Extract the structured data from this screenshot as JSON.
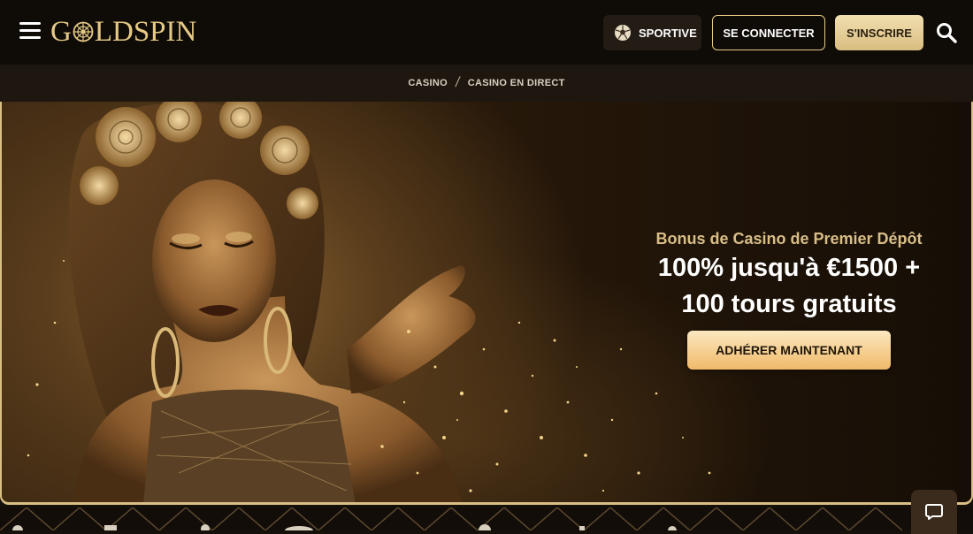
{
  "header": {
    "logo_text_1": "G",
    "logo_text_2": "LDSPIN",
    "sport_label": "SPORTIVE",
    "login_label": "SE CONNECTER",
    "register_label": "S'INSCRIRE"
  },
  "breadcrumb": {
    "items": [
      "CASINO",
      "CASINO EN DIRECT"
    ],
    "separator": "/"
  },
  "hero": {
    "subtitle": "Bonus de Casino de Premier Dépôt",
    "title_line1": "100% jusqu'à €1500 +",
    "title_line2": "100 tours gratuits",
    "cta_label": "ADHÉRER MAINTENANT"
  },
  "colors": {
    "gold": "#e5c985",
    "header_bg": "#0f0b07",
    "crumb_bg": "#1e170f",
    "cta_top": "#fbe8c0",
    "cta_bottom": "#f0b96a"
  },
  "icons": {
    "menu": "hamburger-icon",
    "sport": "soccer-ball-icon",
    "search": "search-icon",
    "chat": "chat-bubble-icon"
  }
}
